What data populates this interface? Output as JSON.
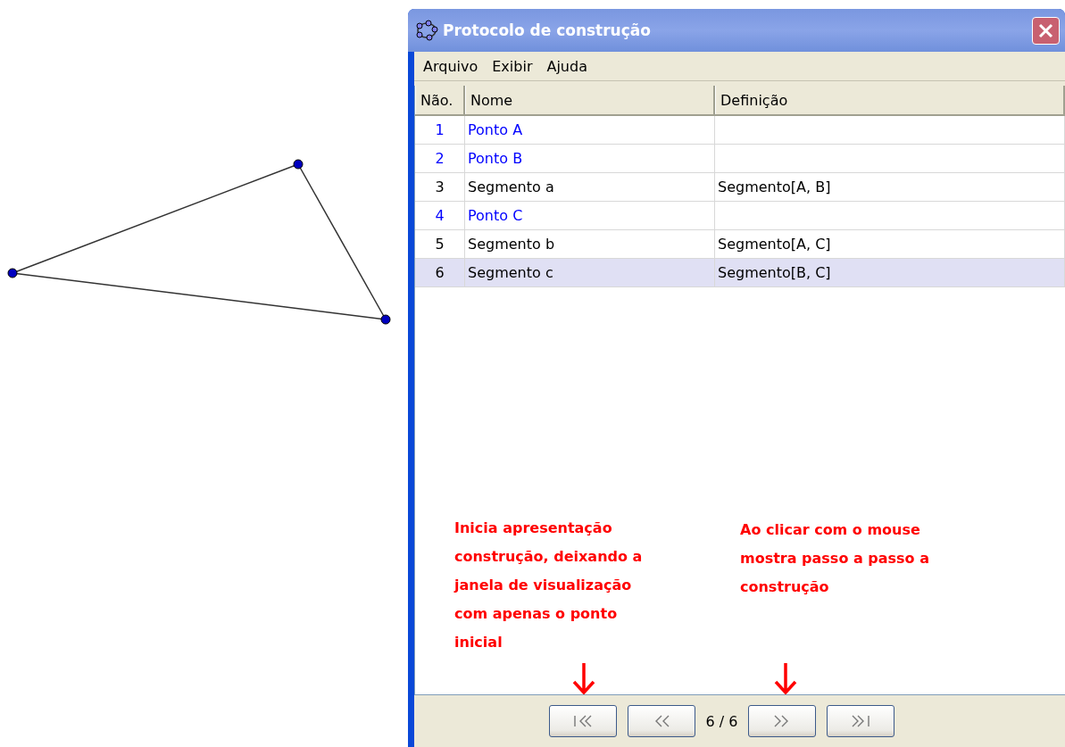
{
  "window": {
    "title": "Protocolo de construção"
  },
  "menu": [
    "Arquivo",
    "Exibir",
    "Ajuda"
  ],
  "table": {
    "columns": [
      "Não.",
      "Nome",
      "Definição"
    ],
    "rows": [
      {
        "number": "1",
        "name": "Ponto A",
        "definition": "",
        "kind": "point",
        "selected": false
      },
      {
        "number": "2",
        "name": "Ponto B",
        "definition": "",
        "kind": "point",
        "selected": false
      },
      {
        "number": "3",
        "name": "Segmento a",
        "definition": "Segmento[A, B]",
        "kind": "segment",
        "selected": false
      },
      {
        "number": "4",
        "name": "Ponto C",
        "definition": "",
        "kind": "point",
        "selected": false
      },
      {
        "number": "5",
        "name": "Segmento b",
        "definition": "Segmento[A, C]",
        "kind": "segment",
        "selected": false
      },
      {
        "number": "6",
        "name": "Segmento c",
        "definition": "Segmento[B, C]",
        "kind": "segment",
        "selected": true
      }
    ]
  },
  "annotations": [
    "Inicia apresentação construção, deixando a janela de visualização com apenas o ponto inicial",
    "Ao clicar com o mouse mostra passo a passo a construção"
  ],
  "navigation": {
    "step": "6 / 6"
  }
}
